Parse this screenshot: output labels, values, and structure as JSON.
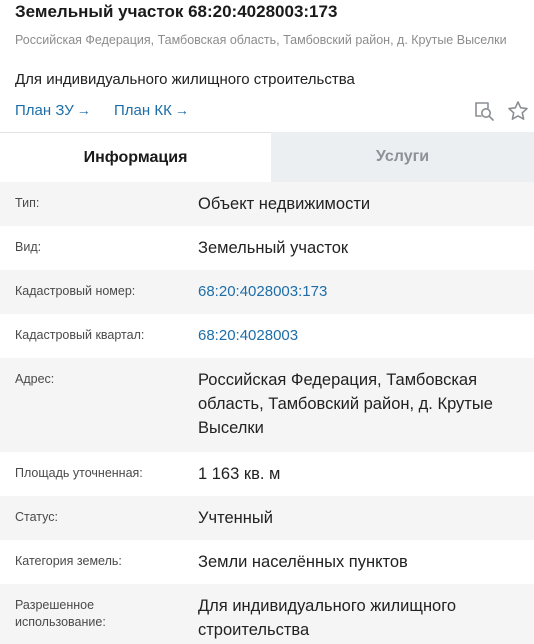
{
  "header": {
    "title": "Земельный участок 68:20:4028003:173",
    "address_subtitle": "Российская Федерация, Тамбовская область, Тамбовский район, д. Крутые Выселки",
    "purpose": "Для индивидуального жилищного строительства",
    "links": [
      {
        "label": "План ЗУ",
        "arrow": "→"
      },
      {
        "label": "План КК",
        "arrow": "→"
      }
    ],
    "icons": [
      "search-map-icon",
      "star-icon"
    ],
    "accent_color": "#1d6ea8"
  },
  "tabs": [
    {
      "label": "Информация",
      "active": true
    },
    {
      "label": "Услуги",
      "active": false
    }
  ],
  "rows": [
    {
      "label": "Тип:",
      "value": "Объект недвижимости"
    },
    {
      "label": "Вид:",
      "value": "Земельный участок"
    },
    {
      "label": "Кадастровый номер:",
      "value": "68:20:4028003:173"
    },
    {
      "label": "Кадастровый квартал:",
      "value": "68:20:4028003"
    },
    {
      "label": "Адрес:",
      "value": "Российская Федерация, Тамбовская область, Тамбовский район, д. Крутые Выселки"
    },
    {
      "label": "Площадь уточненная:",
      "value": "1 163 кв. м"
    },
    {
      "label": "Статус:",
      "value": "Учтенный"
    },
    {
      "label": "Категория земель:",
      "value": "Земли населённых пунктов"
    },
    {
      "label": "Разрешенное использование:",
      "value": "Для индивидуального жилищного строительства"
    }
  ]
}
